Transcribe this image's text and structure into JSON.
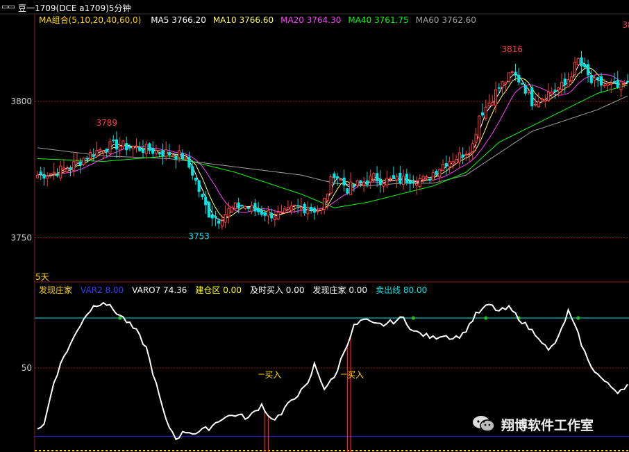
{
  "window": {
    "icon": "window-control-icon",
    "title": "豆一1709(DCE a1709)5分钟"
  },
  "colors": {
    "background": "#000000",
    "up": "#ff3c3c",
    "down": "#00e5e5",
    "ma5": "#ffffff",
    "ma10": "#ffff64",
    "ma20": "#ff40ff",
    "ma40": "#00ff00",
    "ma60": "#a0a0a0",
    "gridline": "#8b1a1a",
    "indicator": "#ffffff",
    "buy_marker": "#ff2020",
    "sell_line": "#00c0c0",
    "low_line": "#2020ff"
  },
  "main_legend": {
    "group": "MA组合(5,10,20,40,60,0)",
    "items": [
      {
        "label": "MA5",
        "value": "3766.20",
        "color": "#ffffff"
      },
      {
        "label": "MA10",
        "value": "3766.60",
        "color": "#ffff64"
      },
      {
        "label": "MA20",
        "value": "3764.30",
        "color": "#ff40ff"
      },
      {
        "label": "MA40",
        "value": "3761.75",
        "color": "#00ff00"
      },
      {
        "label": "MA60",
        "value": "3762.60",
        "color": "#a0a0a0"
      }
    ]
  },
  "sub_legend": {
    "items": [
      {
        "label": "发现庄家",
        "value": "",
        "color": "#ffd700"
      },
      {
        "label": "VAR2",
        "value": "8.00",
        "color": "#3a3aff"
      },
      {
        "label": "VARO7",
        "value": "74.36",
        "color": "#ffffff"
      },
      {
        "label": "建仓区",
        "value": "0.00",
        "color": "#ffff00"
      },
      {
        "label": "及时买入",
        "value": "0.00",
        "color": "#ffffff"
      },
      {
        "label": "发现庄家",
        "value": "0.00",
        "color": "#ffffff"
      },
      {
        "label": "卖出线",
        "value": "80.00",
        "color": "#00e5e5"
      }
    ]
  },
  "period_label": "5天",
  "watermark": {
    "icon": "wechat-icon",
    "text": "翔博软件工作室"
  },
  "chart_data": [
    {
      "type": "line",
      "name": "price-panel",
      "y_ticks": [
        3750,
        3800
      ],
      "ylim": [
        3731,
        3830
      ],
      "x_count": 180,
      "annotations": [
        {
          "text": "3789",
          "x": 21,
          "y": 3789,
          "color": "#ff4040"
        },
        {
          "text": "3753",
          "x": 49,
          "y": 3753,
          "color": "#00e5e5"
        },
        {
          "text": "3816",
          "x": 144,
          "y": 3816,
          "color": "#ff4040"
        },
        {
          "text": "38",
          "x": 179,
          "y": 3825,
          "color": "#ff4040"
        }
      ],
      "close_anchors": [
        [
          0,
          3773
        ],
        [
          5,
          3774
        ],
        [
          10,
          3776
        ],
        [
          15,
          3780
        ],
        [
          20,
          3783
        ],
        [
          24,
          3784
        ],
        [
          30,
          3783
        ],
        [
          35,
          3782
        ],
        [
          40,
          3781
        ],
        [
          44,
          3780
        ],
        [
          47,
          3774
        ],
        [
          50,
          3764
        ],
        [
          52,
          3759
        ],
        [
          55,
          3757
        ],
        [
          58,
          3760
        ],
        [
          62,
          3762
        ],
        [
          66,
          3760
        ],
        [
          70,
          3759
        ],
        [
          74,
          3758
        ],
        [
          78,
          3761
        ],
        [
          82,
          3761
        ],
        [
          86,
          3760
        ],
        [
          90,
          3774
        ],
        [
          94,
          3768
        ],
        [
          98,
          3770
        ],
        [
          102,
          3772
        ],
        [
          106,
          3771
        ],
        [
          110,
          3771
        ],
        [
          114,
          3772
        ],
        [
          118,
          3771
        ],
        [
          120,
          3774
        ],
        [
          124,
          3778
        ],
        [
          128,
          3780
        ],
        [
          132,
          3784
        ],
        [
          134,
          3795
        ],
        [
          136,
          3798
        ],
        [
          140,
          3805
        ],
        [
          144,
          3810
        ],
        [
          147,
          3807
        ],
        [
          150,
          3800
        ],
        [
          155,
          3803
        ],
        [
          160,
          3806
        ],
        [
          164,
          3815
        ],
        [
          168,
          3807
        ],
        [
          172,
          3806
        ],
        [
          176,
          3805
        ],
        [
          179,
          3806
        ]
      ],
      "ma60_anchors": [
        [
          0,
          3783
        ],
        [
          20,
          3780
        ],
        [
          40,
          3779
        ],
        [
          60,
          3776
        ],
        [
          80,
          3773
        ],
        [
          90,
          3770
        ],
        [
          100,
          3769
        ],
        [
          110,
          3770
        ],
        [
          120,
          3770
        ],
        [
          130,
          3773
        ],
        [
          140,
          3781
        ],
        [
          150,
          3789
        ],
        [
          160,
          3793
        ],
        [
          170,
          3797
        ],
        [
          179,
          3802
        ]
      ],
      "ma40_anchors": [
        [
          0,
          3779
        ],
        [
          20,
          3778
        ],
        [
          40,
          3780
        ],
        [
          60,
          3774
        ],
        [
          80,
          3766
        ],
        [
          90,
          3761
        ],
        [
          100,
          3763
        ],
        [
          110,
          3766
        ],
        [
          120,
          3769
        ],
        [
          130,
          3774
        ],
        [
          140,
          3785
        ],
        [
          150,
          3791
        ],
        [
          160,
          3797
        ],
        [
          170,
          3803
        ],
        [
          179,
          3806
        ]
      ]
    },
    {
      "type": "line",
      "name": "indicator-panel",
      "y_ticks": [
        50
      ],
      "ylim": [
        0,
        95
      ],
      "reference_lines": [
        {
          "name": "卖出线",
          "value": 80,
          "color": "#00e5e5"
        },
        {
          "name": "low-line",
          "value": 9,
          "color": "#2020ff"
        }
      ],
      "series_anchors": [
        [
          0,
          14
        ],
        [
          2,
          16
        ],
        [
          5,
          42
        ],
        [
          8,
          57
        ],
        [
          11,
          68
        ],
        [
          14,
          80
        ],
        [
          17,
          87
        ],
        [
          20,
          90
        ],
        [
          23,
          85
        ],
        [
          26,
          80
        ],
        [
          30,
          72
        ],
        [
          33,
          62
        ],
        [
          36,
          40
        ],
        [
          39,
          18
        ],
        [
          42,
          8
        ],
        [
          45,
          12
        ],
        [
          48,
          11
        ],
        [
          52,
          14
        ],
        [
          56,
          20
        ],
        [
          60,
          22
        ],
        [
          64,
          20
        ],
        [
          68,
          28
        ],
        [
          71,
          19
        ],
        [
          74,
          22
        ],
        [
          77,
          31
        ],
        [
          80,
          36
        ],
        [
          82,
          40
        ],
        [
          84,
          52
        ],
        [
          87,
          38
        ],
        [
          90,
          44
        ],
        [
          93,
          60
        ],
        [
          96,
          75
        ],
        [
          99,
          79
        ],
        [
          102,
          76
        ],
        [
          105,
          76
        ],
        [
          108,
          78
        ],
        [
          111,
          80
        ],
        [
          114,
          72
        ],
        [
          117,
          70
        ],
        [
          120,
          68
        ],
        [
          123,
          70
        ],
        [
          126,
          68
        ],
        [
          129,
          70
        ],
        [
          133,
          82
        ],
        [
          137,
          88
        ],
        [
          140,
          84
        ],
        [
          143,
          86
        ],
        [
          146,
          80
        ],
        [
          149,
          74
        ],
        [
          152,
          69
        ],
        [
          155,
          60
        ],
        [
          158,
          68
        ],
        [
          161,
          84
        ],
        [
          164,
          70
        ],
        [
          167,
          54
        ],
        [
          170,
          46
        ],
        [
          173,
          40
        ],
        [
          176,
          36
        ],
        [
          179,
          40
        ]
      ],
      "signals": [
        {
          "text": "买入",
          "x": 70,
          "value": 50,
          "color": "#ffd700"
        },
        {
          "text": "买入",
          "x": 95,
          "value": 50,
          "color": "#ffd700"
        }
      ],
      "dots_at": [
        25,
        114,
        136,
        146,
        164
      ],
      "bars_at": [
        69,
        70,
        94,
        95
      ]
    }
  ]
}
